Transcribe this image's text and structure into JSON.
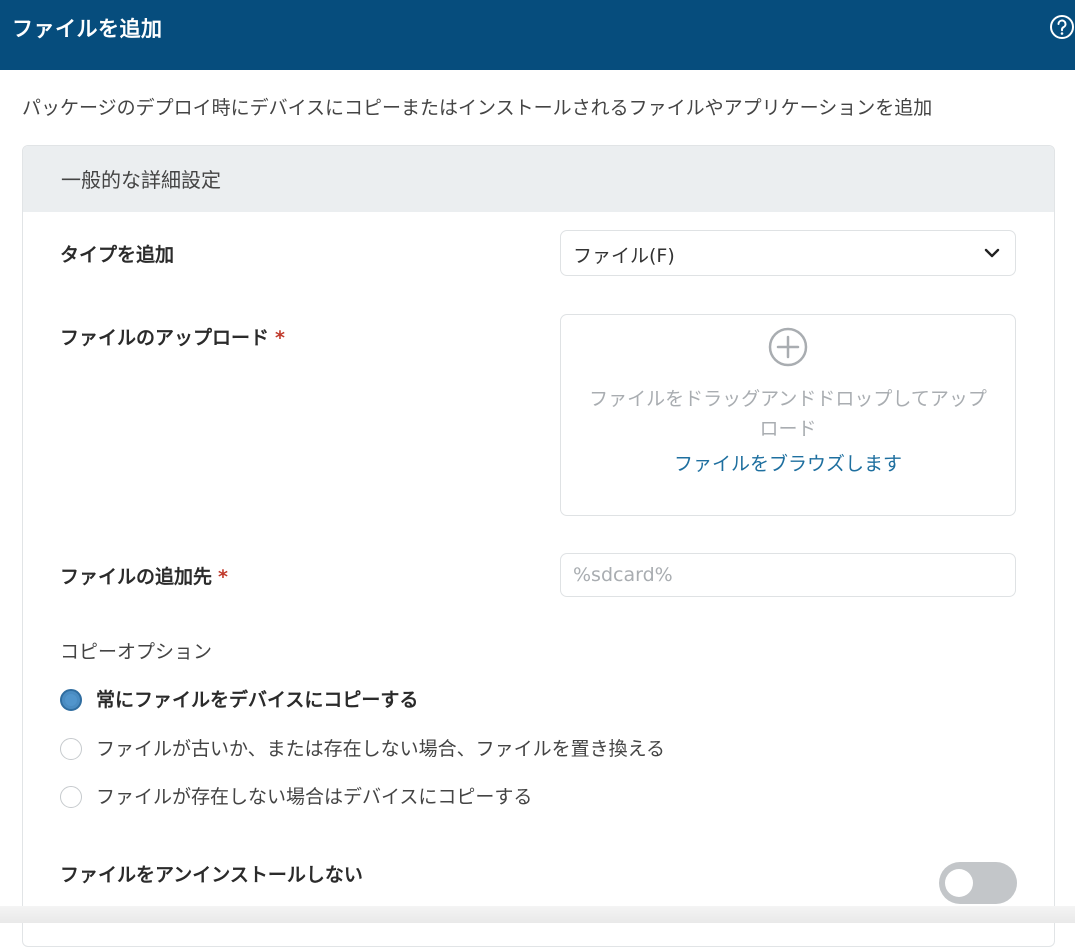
{
  "header": {
    "title": "ファイルを追加",
    "help_icon": "question-circle-icon",
    "background_color": "#064d7d"
  },
  "description": "パッケージのデプロイ時にデバイスにコピーまたはインストールされるファイルやアプリケーションを追加",
  "panel": {
    "title": "一般的な詳細設定"
  },
  "fields": {
    "type": {
      "label": "タイプを追加",
      "selected": "ファイル(F)"
    },
    "upload": {
      "label": "ファイルのアップロード",
      "required_mark": "*",
      "drop_text_line1": "ファイルをドラッグアンドドロップしてアップ",
      "drop_text_line2": "ロード",
      "browse_link": "ファイルをブラウズします",
      "icon": "plus-circle-icon"
    },
    "destination": {
      "label": "ファイルの追加先",
      "required_mark": "*",
      "placeholder": "%sdcard%"
    }
  },
  "copy_options": {
    "label": "コピーオプション",
    "options": [
      {
        "label": "常にファイルをデバイスにコピーする",
        "checked": true
      },
      {
        "label": "ファイルが古いか、または存在しない場合、ファイルを置き換える",
        "checked": false
      },
      {
        "label": "ファイルが存在しない場合はデバイスにコピーする",
        "checked": false
      }
    ]
  },
  "no_uninstall": {
    "label": "ファイルをアンインストールしない",
    "enabled": false
  },
  "colors": {
    "required": "#c0392b",
    "link": "#1e6f9f",
    "radio_checked": "#4a8cc2"
  }
}
